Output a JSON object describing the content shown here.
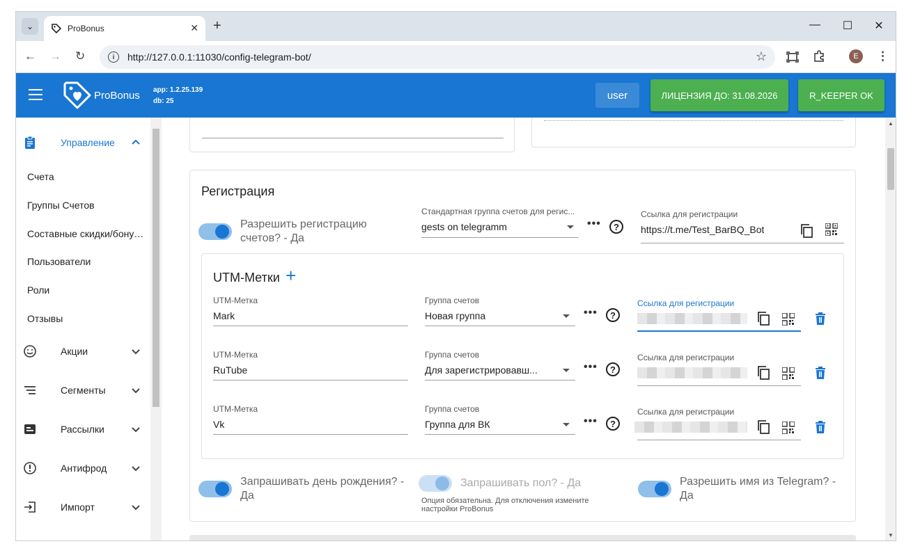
{
  "browser": {
    "tab_title": "ProBonus",
    "url": "http://127.0.0.1:11030/config-telegram-bot/",
    "profile_initial": "E"
  },
  "appbar": {
    "logo_text": "ProBonus",
    "app_version": "app: 1.2.25.139",
    "db_version": "db: 25",
    "user_label": "user",
    "license_label": "ЛИЦЕНЗИЯ ДО: 31.08.2026",
    "keeper_label": "R_KEEPER OK",
    "colors": {
      "primary": "#1976d2",
      "success": "#4caf50"
    }
  },
  "sidebar": {
    "management_label": "Управление",
    "sub_items": [
      "Счета",
      "Группы Счетов",
      "Составные скидки/бонусы",
      "Пользователи",
      "Роли",
      "Отзывы"
    ],
    "sections": [
      {
        "label": "Акции",
        "icon": "smile-icon"
      },
      {
        "label": "Сегменты",
        "icon": "segments-icon"
      },
      {
        "label": "Рассылки",
        "icon": "mail-icon"
      },
      {
        "label": "Антифрод",
        "icon": "alert-icon"
      },
      {
        "label": "Импорт",
        "icon": "import-icon"
      }
    ]
  },
  "registration": {
    "title": "Регистрация",
    "allow_label": "Разрешить регистрацию счетов? - Да",
    "group_label": "Стандартная группа счетов для регис...",
    "group_value": "gests on telegramm",
    "link_label": "Ссылка для регистрации",
    "link_value": "https://t.me/Test_BarBQ_Bot",
    "utm_title": "UTM-Метки",
    "utm_rows": [
      {
        "tag_label": "UTM-Метка",
        "tag": "Mark",
        "group_label": "Группа счетов",
        "group": "Новая группа",
        "link_label": "Ссылка для регистрации"
      },
      {
        "tag_label": "UTM-Метка",
        "tag": "RuTube",
        "group_label": "Группа счетов",
        "group": "Для зарегистрировавш...",
        "link_label": "Ссылка для регистрации"
      },
      {
        "tag_label": "UTM-Метка",
        "tag": "Vk",
        "group_label": "Группа счетов",
        "group": "Группа для ВК",
        "link_label": "Ссылка для регистрации"
      }
    ],
    "birthday_label": "Запрашивать день рождения? - Да",
    "gender_label": "Запрашивать пол? - Да",
    "gender_hint": "Опция обязательна. Для отключения измените настройки ProBonus",
    "tg_name_label": "Разрешить имя из Telegram? - Да"
  }
}
